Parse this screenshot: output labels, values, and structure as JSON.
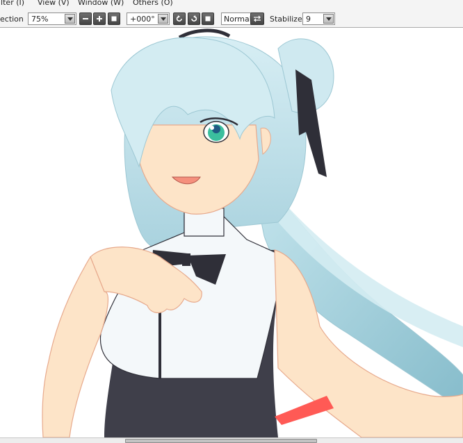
{
  "menu": {
    "items": [
      {
        "label": "ilter (I)"
      },
      {
        "label": "View (V)"
      },
      {
        "label": "Window (W)"
      },
      {
        "label": "Others (O)"
      }
    ]
  },
  "toolbar": {
    "selection_label": "ection",
    "zoom_value": "75%",
    "rotation_value": "+000°",
    "blend_mode": "Normal",
    "stabilizer_label": "Stabilizer",
    "stabilizer_value": "9"
  },
  "icons": {
    "zoom_out": "minus-icon",
    "zoom_in": "plus-icon",
    "zoom_reset": "square-icon",
    "rotate_left": "rotate-ccw-icon",
    "rotate_right": "rotate-cw-icon",
    "rotate_reset": "square-icon",
    "flip": "flip-horizontal-icon"
  },
  "colors": {
    "toolbar_bg": "#f4f4f4",
    "button_dark": "#4a4a4a",
    "hair": "#bfe0ea",
    "skin": "#fde4c8",
    "dress": "#3f3f4a",
    "eye": "#3bbf9e",
    "ribbon": "#ff5a55"
  }
}
